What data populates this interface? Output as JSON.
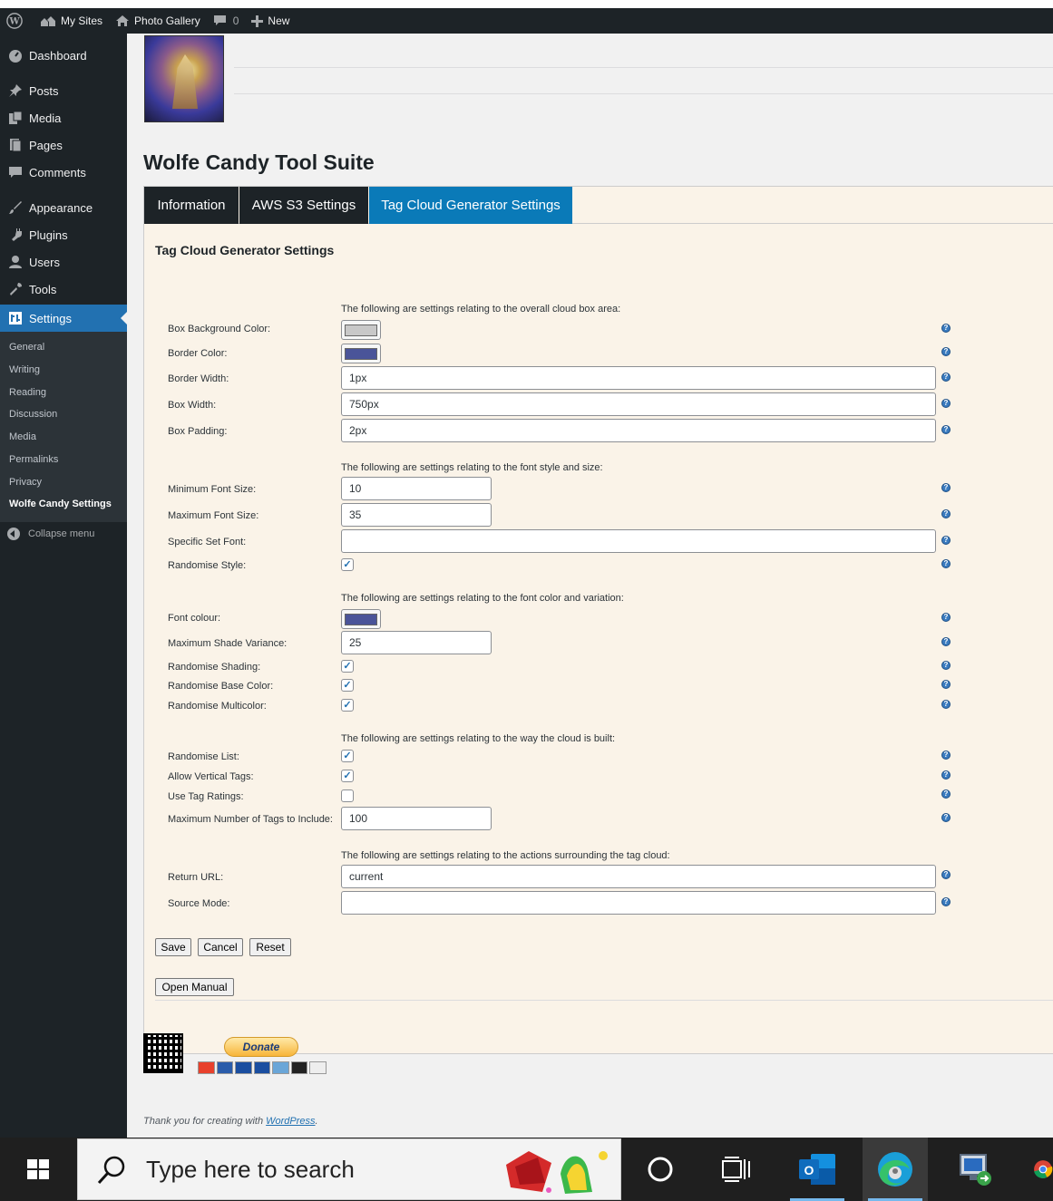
{
  "adminbar": {
    "my_sites": "My Sites",
    "site_name": "Photo Gallery",
    "comments_count": "0",
    "new_label": "New"
  },
  "sidebar": {
    "items": [
      {
        "label": "Dashboard",
        "icon": "dashboard-icon"
      },
      {
        "label": "Posts",
        "icon": "pin-icon"
      },
      {
        "label": "Media",
        "icon": "media-icon"
      },
      {
        "label": "Pages",
        "icon": "pages-icon"
      },
      {
        "label": "Comments",
        "icon": "comment-icon"
      },
      {
        "label": "Appearance",
        "icon": "brush-icon"
      },
      {
        "label": "Plugins",
        "icon": "plugin-icon"
      },
      {
        "label": "Users",
        "icon": "user-icon"
      },
      {
        "label": "Tools",
        "icon": "wrench-icon"
      },
      {
        "label": "Settings",
        "icon": "settings-icon"
      }
    ],
    "submenu": [
      "General",
      "Writing",
      "Reading",
      "Discussion",
      "Media",
      "Permalinks",
      "Privacy",
      "Wolfe Candy Settings"
    ],
    "collapse": "Collapse menu"
  },
  "page": {
    "title": "Wolfe Candy Tool Suite",
    "tabs": [
      "Information",
      "AWS S3 Settings",
      "Tag Cloud Generator Settings"
    ],
    "panel_title": "Tag Cloud Generator Settings"
  },
  "sections": {
    "box": "The following are settings relating to the overall cloud box area:",
    "font": "The following are settings relating to the font style and size:",
    "color": "The following are settings relating to the font color and variation:",
    "build": "The following are settings relating to the way the cloud is built:",
    "actions": "The following are settings relating to the actions surrounding the tag cloud:"
  },
  "fields": {
    "box_bg_color": {
      "label": "Box Background Color:",
      "color": "#c8c8c8"
    },
    "border_color": {
      "label": "Border Color:",
      "color": "#4a5499"
    },
    "border_width": {
      "label": "Border Width:",
      "value": "1px"
    },
    "box_width": {
      "label": "Box Width:",
      "value": "750px"
    },
    "box_padding": {
      "label": "Box Padding:",
      "value": "2px"
    },
    "min_font": {
      "label": "Minimum Font Size:",
      "value": "10"
    },
    "max_font": {
      "label": "Maximum Font Size:",
      "value": "35"
    },
    "set_font": {
      "label": "Specific Set Font:",
      "value": ""
    },
    "randomise_style": {
      "label": "Randomise Style:",
      "checked": true
    },
    "font_colour": {
      "label": "Font colour:",
      "color": "#4a5499"
    },
    "max_shade": {
      "label": "Maximum Shade Variance:",
      "value": "25"
    },
    "rand_shading": {
      "label": "Randomise Shading:",
      "checked": true
    },
    "rand_base": {
      "label": "Randomise Base Color:",
      "checked": true
    },
    "rand_multi": {
      "label": "Randomise Multicolor:",
      "checked": true
    },
    "rand_list": {
      "label": "Randomise List:",
      "checked": true
    },
    "vertical_tags": {
      "label": "Allow Vertical Tags:",
      "checked": true
    },
    "tag_ratings": {
      "label": "Use Tag Ratings:",
      "checked": false
    },
    "max_tags": {
      "label": "Maximum Number of Tags to Include:",
      "value": "100"
    },
    "return_url": {
      "label": "Return URL:",
      "value": "current"
    },
    "source_mode": {
      "label": "Source Mode:",
      "value": ""
    }
  },
  "buttons": {
    "save": "Save",
    "cancel": "Cancel",
    "reset": "Reset",
    "manual": "Open Manual",
    "donate": "Donate"
  },
  "footer": {
    "text": "Thank you for creating with ",
    "link": "WordPress",
    "end": "."
  },
  "taskbar": {
    "search_placeholder": "Type here to search"
  },
  "colors": {
    "accent": "#2271b1",
    "active_tab": "#0a7ab8",
    "panel_bg": "#faf3e8"
  }
}
